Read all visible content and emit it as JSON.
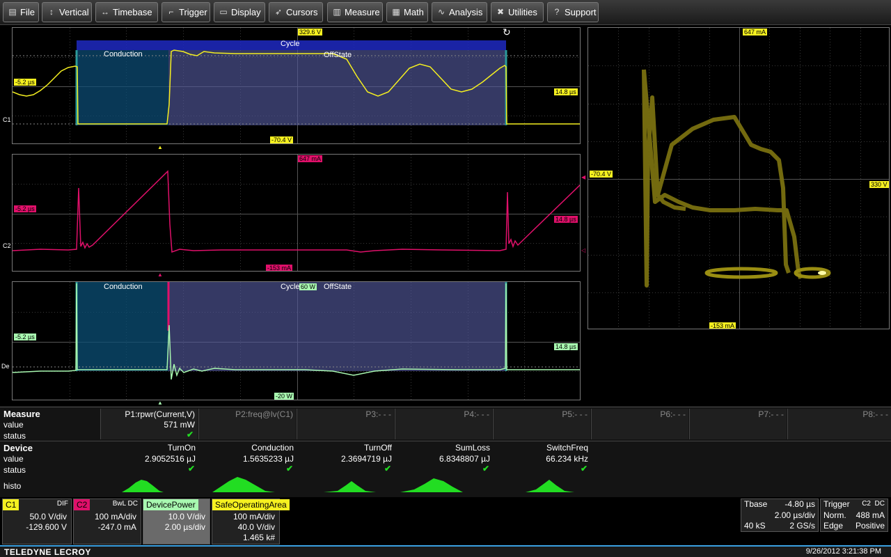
{
  "menu": [
    {
      "label": "File",
      "icon": "file-icon",
      "glyph": "▤"
    },
    {
      "label": "Vertical",
      "icon": "vertical-icon",
      "glyph": "↕"
    },
    {
      "label": "Timebase",
      "icon": "timebase-icon",
      "glyph": "↔"
    },
    {
      "label": "Trigger",
      "icon": "trigger-icon",
      "glyph": "⌐"
    },
    {
      "label": "Display",
      "icon": "display-icon",
      "glyph": "▭"
    },
    {
      "label": "Cursors",
      "icon": "cursors-icon",
      "glyph": "➶"
    },
    {
      "label": "Measure",
      "icon": "measure-icon",
      "glyph": "▥"
    },
    {
      "label": "Math",
      "icon": "math-icon",
      "glyph": "▦"
    },
    {
      "label": "Analysis",
      "icon": "analysis-icon",
      "glyph": "∿"
    },
    {
      "label": "Utilities",
      "icon": "utilities-icon",
      "glyph": "✖"
    },
    {
      "label": "Support",
      "icon": "support-icon",
      "glyph": "?"
    }
  ],
  "grid1": {
    "top_tag": "329.6 V",
    "bottom_tag": "-70.4 V",
    "left_tag": "-5.2 µs",
    "right_tag": "14.8 µs",
    "channel": "C1",
    "cycle": "Cycle",
    "conduction": "Conduction",
    "offstate": "OffState"
  },
  "grid2": {
    "top_tag": "647 mA",
    "bottom_tag": "-153 mA",
    "left_tag": "-5.2 µs",
    "right_tag": "14.8 µs",
    "channel": "C2"
  },
  "grid3": {
    "top_tag": "60 W",
    "bottom_tag": "-20 W",
    "left_tag": "-5.2 µs",
    "right_tag": "14.8 µs",
    "channel": "De",
    "cycle": "Cycle",
    "conduction": "Conduction",
    "offstate": "OffState"
  },
  "xy": {
    "top_tag": "647 mA",
    "bottom_tag": "-153 mA",
    "left_tag": "-70.4 V",
    "right_tag": "330 V"
  },
  "measure": {
    "title": "Measure",
    "value_label": "value",
    "status_label": "status",
    "params": [
      {
        "name": "P1:rpwr(Current,V)",
        "value": "571 mW",
        "active": true
      },
      {
        "name": "P2:freq@lv(C1)",
        "value": "",
        "active": false
      },
      {
        "name": "P3:- - -",
        "value": "",
        "active": false
      },
      {
        "name": "P4:- - -",
        "value": "",
        "active": false
      },
      {
        "name": "P5:- - -",
        "value": "",
        "active": false
      },
      {
        "name": "P6:- - -",
        "value": "",
        "active": false
      },
      {
        "name": "P7:- - -",
        "value": "",
        "active": false
      },
      {
        "name": "P8:- - -",
        "value": "",
        "active": false
      }
    ],
    "check": "✔"
  },
  "device": {
    "title": "Device",
    "value_label": "value",
    "status_label": "status",
    "histo_label": "histo",
    "cols": [
      {
        "name": "TurnOn",
        "value": "2.9052516 µJ"
      },
      {
        "name": "Conduction",
        "value": "1.5635233 µJ"
      },
      {
        "name": "TurnOff",
        "value": "2.3694719 µJ"
      },
      {
        "name": "SumLoss",
        "value": "6.8348807 µJ"
      },
      {
        "name": "SwitchFreq",
        "value": "66.234 kHz"
      }
    ]
  },
  "descriptors": {
    "c1": {
      "name": "C1",
      "sub": "DIF",
      "l1": "50.0 V/div",
      "l2": "-129.600 V",
      "color": "#f5f020"
    },
    "c2": {
      "name": "C2",
      "sub": "BwL  DC",
      "l1": "100 mA/div",
      "l2": "-247.0 mA",
      "color": "#e0106a"
    },
    "dp": {
      "name": "DevicePower",
      "l1": "10.0 V/div",
      "l2": "2.00 µs/div",
      "color": "#a8f8b0"
    },
    "soa": {
      "name": "SafeOperatingArea",
      "l1": "100 mA/div",
      "l2": "40.0 V/div",
      "l3": "1.465 k#",
      "color": "#f5f020"
    },
    "tbase": {
      "name": "Tbase",
      "offset": "-4.80 µs",
      "div": "2.00 µs/div",
      "samples": "40 kS",
      "rate": "2 GS/s"
    },
    "trigger": {
      "name": "Trigger",
      "src": "C2",
      "coup": "DC",
      "mode": "Norm.",
      "level": "488 mA",
      "type": "Edge",
      "slope": "Positive"
    }
  },
  "footer": {
    "brand": "TELEDYNE LECROY",
    "datetime": "9/26/2012 3:21:38 PM"
  }
}
